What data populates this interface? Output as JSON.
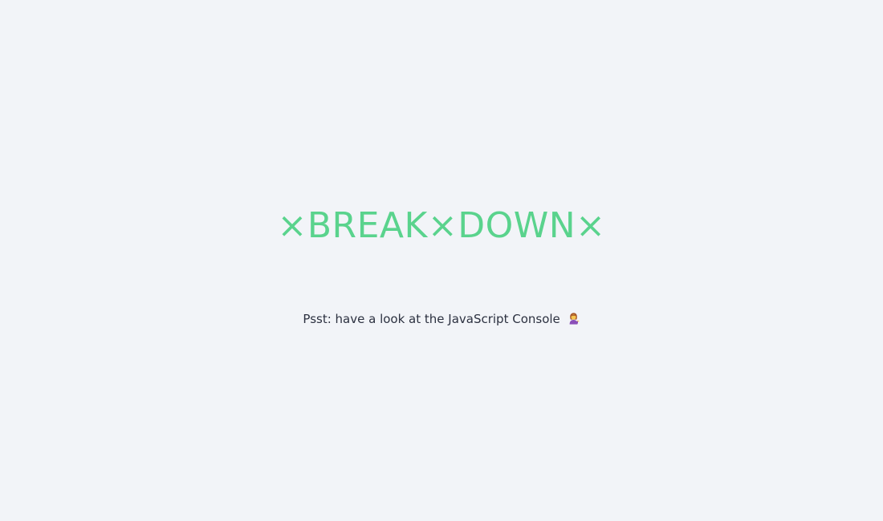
{
  "heading": {
    "text": "×BREAK×DOWN×",
    "color": "#5ad38d"
  },
  "hint": {
    "text": "Psst: have a look at the JavaScript Console",
    "icon": "person-tipping-hand-icon"
  },
  "colors": {
    "background": "#f2f4f8",
    "text": "#2c3140"
  }
}
